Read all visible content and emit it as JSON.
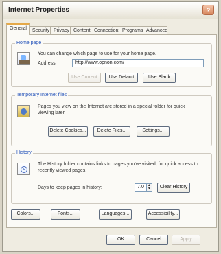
{
  "window": {
    "title": "Internet Properties",
    "help_glyph": "?"
  },
  "tabs": [
    {
      "label": "General"
    },
    {
      "label": "Security"
    },
    {
      "label": "Privacy"
    },
    {
      "label": "Content"
    },
    {
      "label": "Connections"
    },
    {
      "label": "Programs"
    },
    {
      "label": "Advanced"
    }
  ],
  "home_page": {
    "legend": "Home page",
    "description": "You can change which page to use for your home page.",
    "address_label": "Address:",
    "address_value": "http://www.opnon.com/",
    "buttons": {
      "use_current": "Use Current",
      "use_default": "Use Default",
      "use_blank": "Use Blank"
    }
  },
  "temp_files": {
    "legend": "Temporary Internet files",
    "description": "Pages you view on the Internet are stored in a special folder for quick viewing later.",
    "buttons": {
      "delete_cookies": "Delete Cookies...",
      "delete_files": "Delete Files...",
      "settings": "Settings..."
    }
  },
  "history": {
    "legend": "History",
    "description": "The History folder contains links to pages you've visited, for quick access to recently viewed pages.",
    "days_label": "Days to keep pages in history:",
    "days_value": "7.0",
    "clear_button": "Clear History"
  },
  "footer_buttons": {
    "colors": "Colors...",
    "fonts": "Fonts...",
    "languages": "Languages...",
    "accessibility": "Accessibility..."
  },
  "dialog_buttons": {
    "ok": "OK",
    "cancel": "Cancel",
    "apply": "Apply"
  }
}
